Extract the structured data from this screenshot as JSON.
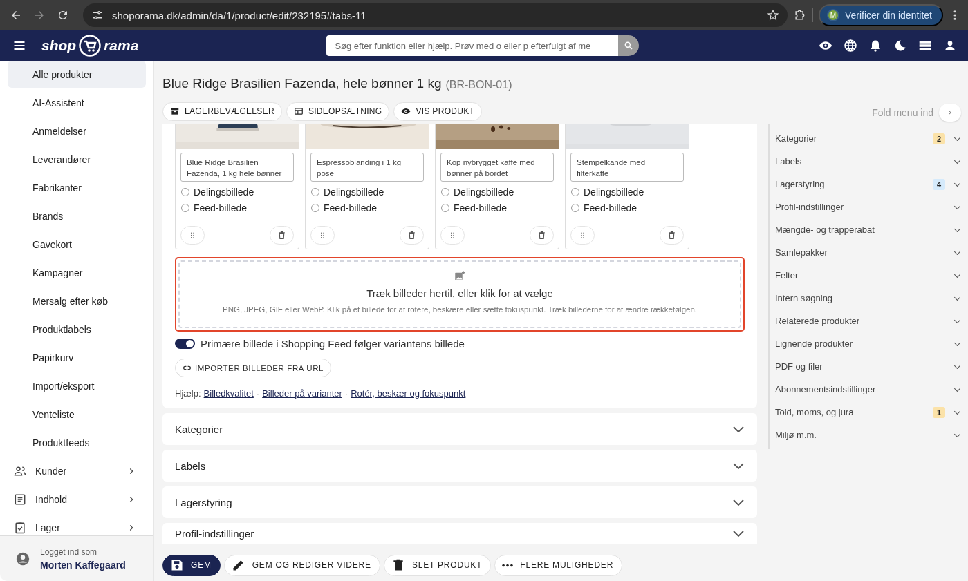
{
  "browser": {
    "url": "shoporama.dk/admin/da/1/product/edit/232195#tabs-11",
    "profile_initial": "M",
    "profile_button": "Verificer din identitet"
  },
  "header": {
    "logo_left": "shop",
    "logo_right": "rama",
    "search_placeholder": "Søg efter funktion eller hjælp. Prøv med o eller p efterfulgt af me"
  },
  "sidebar": {
    "items": [
      {
        "label": "Alle produkter",
        "kind": "sub",
        "selected": true
      },
      {
        "label": "AI-Assistent",
        "kind": "sub",
        "selected": false
      },
      {
        "label": "Anmeldelser",
        "kind": "sub",
        "selected": false
      },
      {
        "label": "Leverandører",
        "kind": "sub",
        "selected": false
      },
      {
        "label": "Fabrikanter",
        "kind": "sub",
        "selected": false
      },
      {
        "label": "Brands",
        "kind": "sub",
        "selected": false
      },
      {
        "label": "Gavekort",
        "kind": "sub",
        "selected": false
      },
      {
        "label": "Kampagner",
        "kind": "sub",
        "selected": false
      },
      {
        "label": "Mersalg efter køb",
        "kind": "sub",
        "selected": false
      },
      {
        "label": "Produktlabels",
        "kind": "sub",
        "selected": false
      },
      {
        "label": "Papirkurv",
        "kind": "sub",
        "selected": false
      },
      {
        "label": "Import/eksport",
        "kind": "sub",
        "selected": false
      },
      {
        "label": "Venteliste",
        "kind": "sub",
        "selected": false
      },
      {
        "label": "Produktfeeds",
        "kind": "sub",
        "selected": false
      },
      {
        "label": "Kunder",
        "kind": "group",
        "selected": false
      },
      {
        "label": "Indhold",
        "kind": "group",
        "selected": false
      },
      {
        "label": "Lager",
        "kind": "group",
        "selected": false
      }
    ],
    "user": {
      "caption": "Logget ind som",
      "name": "Morten Kaffegaard"
    }
  },
  "product": {
    "title": "Blue Ridge Brasilien Fazenda, hele bønner 1 kg",
    "sku": "(BR-BON-01)"
  },
  "toolbar": [
    "LAGERBEVÆGELSER",
    "SIDEOPSÆTNING",
    "VIS PRODUKT"
  ],
  "images": [
    {
      "caption": "Blue Ridge Brasilien Fazenda, 1 kg hele bønner",
      "share_label": "Delingsbillede",
      "share": false,
      "feed_label": "Feed-billede",
      "feed": false
    },
    {
      "caption": "Espressoblanding i 1 kg pose",
      "share_label": "Delingsbillede",
      "share": false,
      "feed_label": "Feed-billede",
      "feed": false
    },
    {
      "caption": "Kop nybrygget kaffe med bønner på bordet",
      "share_label": "Delingsbillede",
      "share": false,
      "feed_label": "Feed-billede",
      "feed": false
    },
    {
      "caption": "Stempelkande med filterkaffe",
      "share_label": "Delingsbillede",
      "share": false,
      "feed_label": "Feed-billede",
      "feed": false
    }
  ],
  "dropzone": {
    "title": "Træk billeder hertil, eller klik for at vælge",
    "hint": "PNG, JPEG, GIF eller WebP. Klik på et billede for at rotere, beskære eller sætte fokuspunkt. Træk billederne for at ændre rækkefølgen.",
    "highlighted": true
  },
  "feed_toggle": {
    "label": "Primære billede i Shopping Feed følger variantens billede",
    "on": true
  },
  "import_button": "IMPORTER BILLEDER FRA URL",
  "help": {
    "label": "Hjælp:",
    "links": [
      "Billedkvalitet",
      "Billeder på varianter",
      "Rotér, beskær og fokuspunkt"
    ],
    "separators": [
      "·",
      "·"
    ]
  },
  "sections": [
    {
      "title": "Kategorier",
      "expanded": false
    },
    {
      "title": "Labels",
      "expanded": false
    },
    {
      "title": "Lagerstyring",
      "expanded": false
    },
    {
      "title": "Profil-indstillinger",
      "expanded": false
    }
  ],
  "actions": [
    {
      "label": "GEM",
      "kind": "primary"
    },
    {
      "label": "GEM OG REDIGER VIDERE",
      "kind": "secondary"
    },
    {
      "label": "SLET PRODUKT",
      "kind": "secondary"
    },
    {
      "label": "FLERE MULIGHEDER",
      "kind": "secondary"
    }
  ],
  "right_panel": {
    "fold_label": "Fold menu ind",
    "items": [
      {
        "label": "Kategorier",
        "badge": "2",
        "color": "#fbe2a8"
      },
      {
        "label": "Labels"
      },
      {
        "label": "Lagerstyring",
        "badge": "4",
        "color": "#d5eafb"
      },
      {
        "label": "Profil-indstillinger"
      },
      {
        "label": "Mængde- og trapperabat"
      },
      {
        "label": "Samlepakker"
      },
      {
        "label": "Felter"
      },
      {
        "label": "Intern søgning"
      },
      {
        "label": "Relaterede produkter"
      },
      {
        "label": "Lignende produkter"
      },
      {
        "label": "PDF og filer"
      },
      {
        "label": "Abonnementsindstillinger"
      },
      {
        "label": "Told, moms, og jura",
        "badge": "1",
        "color": "#fbe2a8"
      },
      {
        "label": "Miljø m.m."
      }
    ]
  }
}
